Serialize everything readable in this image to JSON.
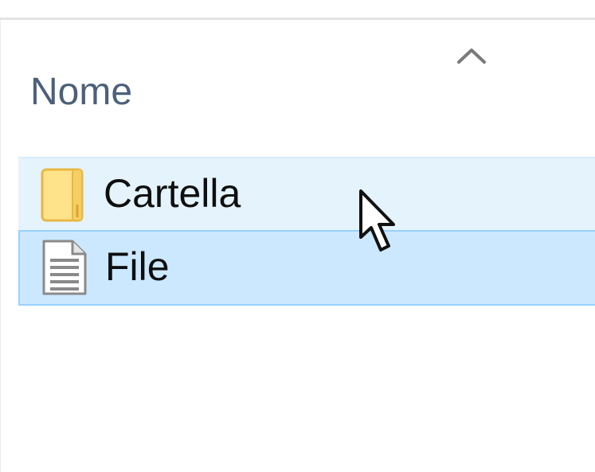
{
  "header": {
    "column_name": "Nome",
    "sort_indicator_icon": "chevron-up-icon"
  },
  "items": [
    {
      "label": "Cartella",
      "icon": "folder-icon",
      "state": "hover"
    },
    {
      "label": "File",
      "icon": "document-icon",
      "state": "selected"
    }
  ],
  "colors": {
    "hover_background": "#e5f3fd",
    "selected_background": "#cce8ff",
    "selected_border": "#99d1ff",
    "header_text": "#4c607a",
    "folder": "#ffe38a"
  },
  "cursor_icon": "mouse-pointer-icon"
}
